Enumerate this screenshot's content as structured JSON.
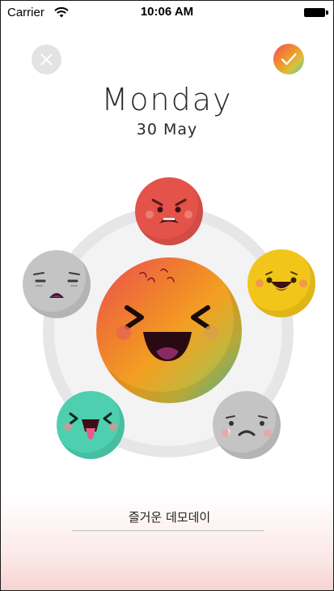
{
  "status_bar": {
    "carrier": "Carrier",
    "time": "10:06 AM",
    "icons": [
      "wifi-icon",
      "battery-icon"
    ]
  },
  "header": {
    "close_icon": "close-icon",
    "confirm_icon": "check-icon",
    "day": "Monday",
    "date": "30 May"
  },
  "moods": [
    {
      "id": "angry",
      "color": "#e3534a"
    },
    {
      "id": "happy",
      "color": "#f2c51b"
    },
    {
      "id": "tired",
      "color": "#c4c4c4"
    },
    {
      "id": "silly",
      "color": "#4ecfb0"
    },
    {
      "id": "sad",
      "color": "#c4c4c4"
    }
  ],
  "selected_mood": {
    "id": "ecstatic",
    "gradient": [
      "#ec4b55",
      "#f0822b",
      "#f2a022",
      "#4ec1a6"
    ]
  },
  "note": {
    "value": "즐거운 데모데이"
  },
  "colors": {
    "ring": "#e6e6e8",
    "ring_inner": "#f2f2f3",
    "accent_gradient": [
      "#ee4d5f",
      "#f0962a",
      "#d7c23f",
      "#4cc59f"
    ]
  }
}
